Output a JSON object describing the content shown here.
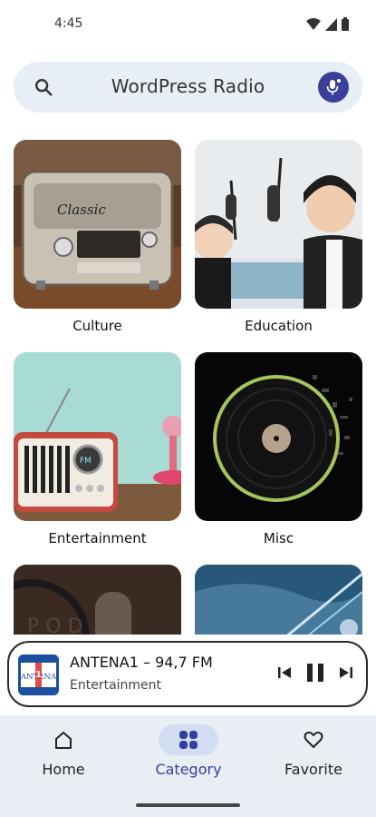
{
  "status_bar": {
    "time": "4:45"
  },
  "search": {
    "placeholder": "WordPress Radio"
  },
  "categories": [
    {
      "label": "Culture"
    },
    {
      "label": "Education"
    },
    {
      "label": "Entertainment"
    },
    {
      "label": "Misc"
    },
    {
      "label": ""
    },
    {
      "label": ""
    }
  ],
  "player": {
    "title": "ANTENA1 – 94,7 FM",
    "subtitle": "Entertainment",
    "logo_text": "ANTENA",
    "logo_badge": "1"
  },
  "nav": {
    "home": "Home",
    "category": "Category",
    "favorite": "Favorite"
  },
  "colors": {
    "accent": "#3140a0",
    "search_bg": "#e7eef5",
    "nav_bg": "#e9eef5",
    "active_pill": "#d3ddf1"
  },
  "icons": [
    "wifi-icon",
    "signal-icon",
    "battery-icon",
    "search-icon",
    "mic-icon",
    "skip-previous-icon",
    "pause-icon",
    "skip-next-icon",
    "home-icon",
    "category-icon",
    "heart-icon"
  ]
}
